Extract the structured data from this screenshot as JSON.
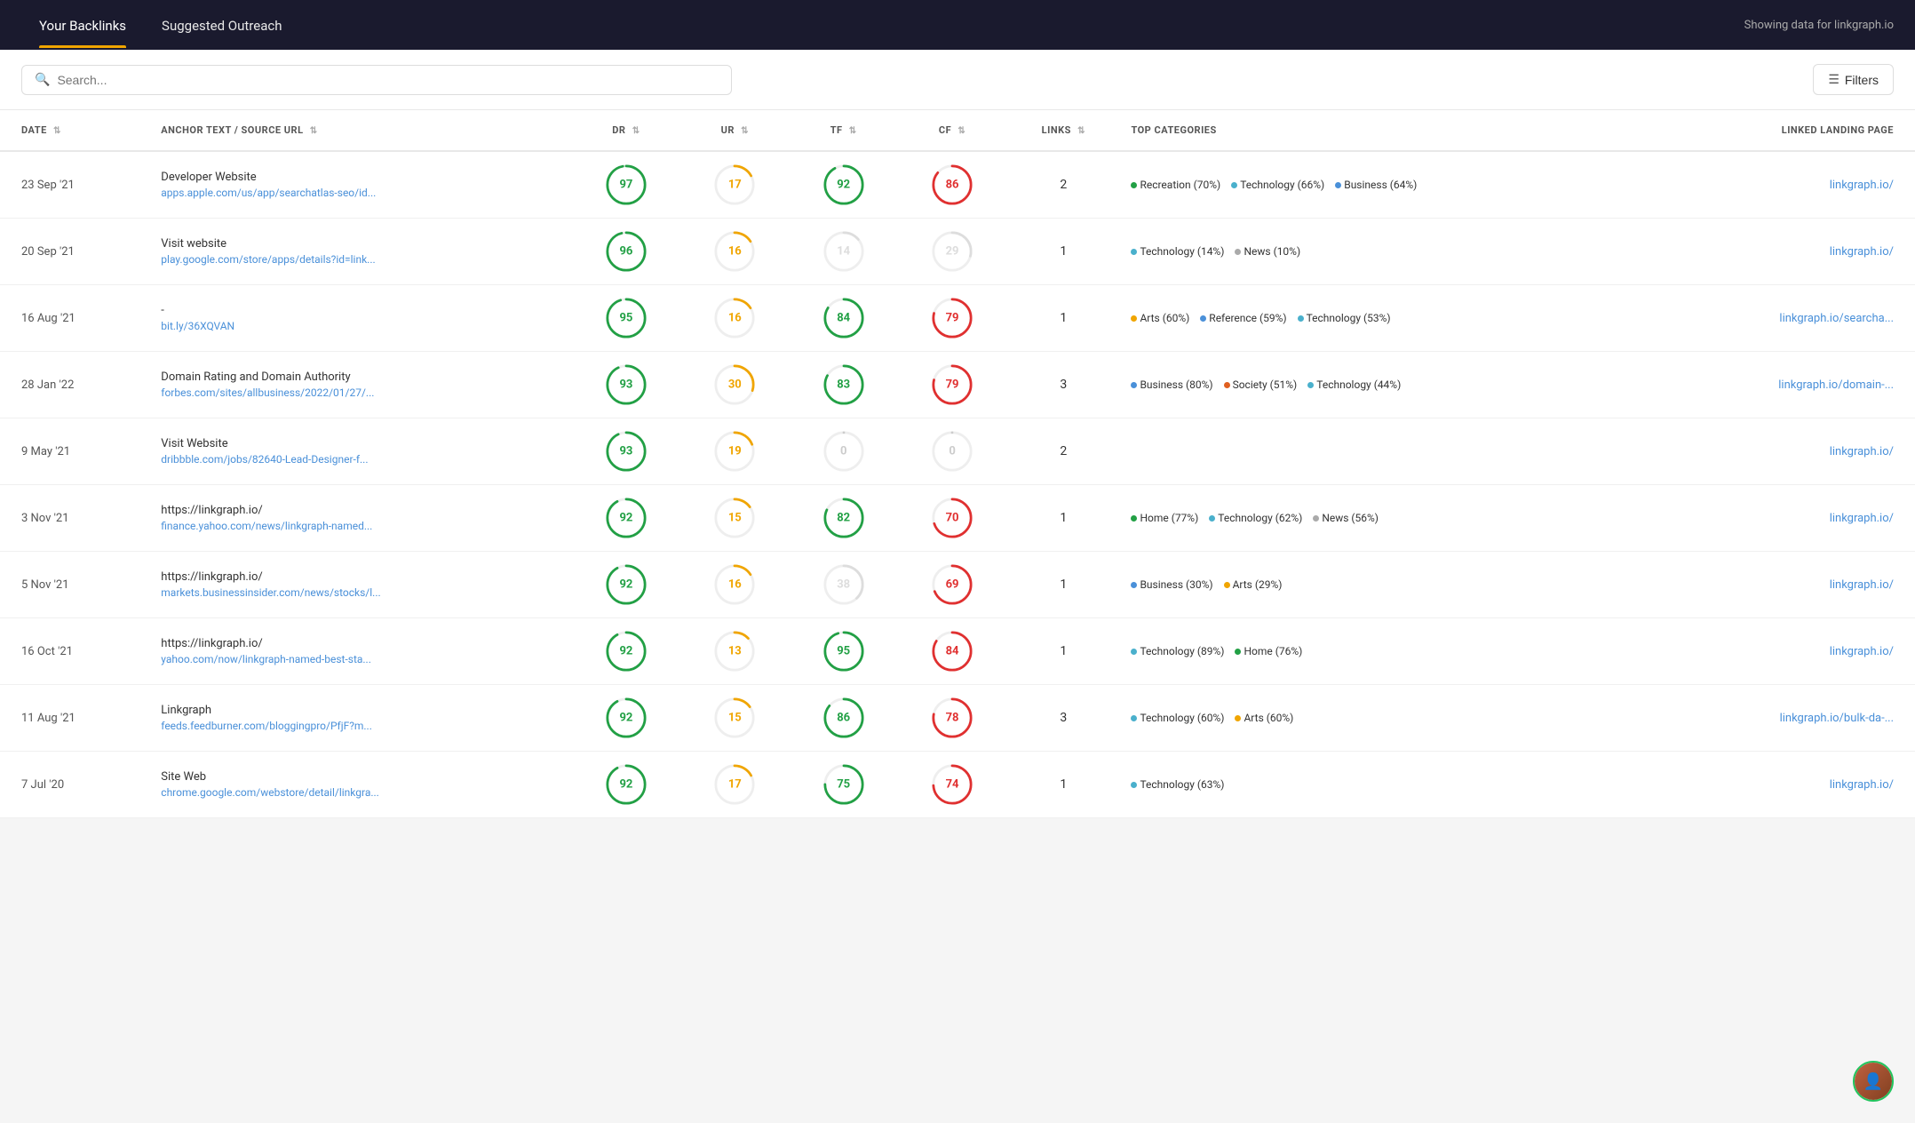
{
  "nav": {
    "tab1": "Your Backlinks",
    "tab2": "Suggested Outreach",
    "showing": "Showing data for linkgraph.io"
  },
  "toolbar": {
    "search_placeholder": "Search...",
    "filters_label": "Filters"
  },
  "table": {
    "columns": [
      "DATE",
      "ANCHOR TEXT / SOURCE URL",
      "DR",
      "UR",
      "TF",
      "CF",
      "LINKS",
      "TOP CATEGORIES",
      "LINKED LANDING PAGE"
    ],
    "rows": [
      {
        "date": "23 Sep '21",
        "anchor": "Developer Website",
        "url": "apps.apple.com/us/app/searchatlas-seo/id...",
        "dr": 97,
        "dr_color": "#22a045",
        "dr_stroke": "#22a045",
        "dr_pct": 97,
        "ur": 17,
        "ur_color": "#f0a500",
        "ur_stroke": "#f0a500",
        "ur_pct": 17,
        "tf": 92,
        "tf_color": "#22a045",
        "tf_stroke": "#22a045",
        "tf_pct": 92,
        "cf": 86,
        "cf_color": "#e03030",
        "cf_stroke": "#e03030",
        "cf_pct": 86,
        "links": 2,
        "categories": [
          {
            "dot": "#22a045",
            "label": "Recreation (70%)"
          },
          {
            "dot": "#4ab0cc",
            "label": "Technology (66%)"
          },
          {
            "dot": "#4a90d9",
            "label": "Business (64%)"
          }
        ],
        "landing": "linkgraph.io/"
      },
      {
        "date": "20 Sep '21",
        "anchor": "Visit website",
        "url": "play.google.com/store/apps/details?id=link...",
        "dr": 96,
        "dr_color": "#22a045",
        "dr_stroke": "#22a045",
        "dr_pct": 96,
        "ur": 16,
        "ur_color": "#f0a500",
        "ur_stroke": "#f0a500",
        "ur_pct": 16,
        "tf": 14,
        "tf_color": "#999",
        "tf_stroke": "#ddd",
        "tf_pct": 14,
        "cf": 29,
        "cf_color": "#999",
        "cf_stroke": "#ddd",
        "cf_pct": 29,
        "links": 1,
        "categories": [
          {
            "dot": "#4ab0cc",
            "label": "Technology (14%)"
          },
          {
            "dot": "#aaa",
            "label": "News (10%)"
          }
        ],
        "landing": "linkgraph.io/"
      },
      {
        "date": "16 Aug '21",
        "anchor": "-",
        "url": "bit.ly/36XQVAN",
        "dr": 95,
        "dr_color": "#22a045",
        "dr_stroke": "#22a045",
        "dr_pct": 95,
        "ur": 16,
        "ur_color": "#f0a500",
        "ur_stroke": "#f0a500",
        "ur_pct": 16,
        "tf": 84,
        "tf_color": "#22a045",
        "tf_stroke": "#22a045",
        "tf_pct": 84,
        "cf": 79,
        "cf_color": "#e03030",
        "cf_stroke": "#e03030",
        "cf_pct": 79,
        "links": 1,
        "categories": [
          {
            "dot": "#f0a500",
            "label": "Arts (60%)"
          },
          {
            "dot": "#4a90d9",
            "label": "Reference (59%)"
          },
          {
            "dot": "#4ab0cc",
            "label": "Technology (53%)"
          }
        ],
        "landing": "linkgraph.io/searcha..."
      },
      {
        "date": "28 Jan '22",
        "anchor": "Domain Rating and Domain Authority",
        "url": "forbes.com/sites/allbusiness/2022/01/27/...",
        "dr": 93,
        "dr_color": "#22a045",
        "dr_stroke": "#22a045",
        "dr_pct": 93,
        "ur": 30,
        "ur_color": "#f0a500",
        "ur_stroke": "#f0a500",
        "ur_pct": 30,
        "tf": 83,
        "tf_color": "#22a045",
        "tf_stroke": "#22a045",
        "tf_pct": 83,
        "cf": 79,
        "cf_color": "#e03030",
        "cf_stroke": "#e03030",
        "cf_pct": 79,
        "links": 3,
        "categories": [
          {
            "dot": "#4a90d9",
            "label": "Business (80%)"
          },
          {
            "dot": "#e06020",
            "label": "Society (51%)"
          },
          {
            "dot": "#4ab0cc",
            "label": "Technology (44%)"
          }
        ],
        "landing": "linkgraph.io/domain-..."
      },
      {
        "date": "9 May '21",
        "anchor": "Visit Website",
        "url": "dribbble.com/jobs/82640-Lead-Designer-f...",
        "dr": 93,
        "dr_color": "#22a045",
        "dr_stroke": "#22a045",
        "dr_pct": 93,
        "ur": 19,
        "ur_color": "#f0a500",
        "ur_stroke": "#f0a500",
        "ur_pct": 19,
        "tf": 0,
        "tf_color": "#999",
        "tf_stroke": "#ddd",
        "tf_pct": 0,
        "cf": 0,
        "cf_color": "#999",
        "cf_stroke": "#ddd",
        "cf_pct": 0,
        "links": 2,
        "categories": [],
        "landing": "linkgraph.io/"
      },
      {
        "date": "3 Nov '21",
        "anchor": "https://linkgraph.io/",
        "url": "finance.yahoo.com/news/linkgraph-named...",
        "dr": 92,
        "dr_color": "#22a045",
        "dr_stroke": "#22a045",
        "dr_pct": 92,
        "ur": 15,
        "ur_color": "#f0a500",
        "ur_stroke": "#f0a500",
        "ur_pct": 15,
        "tf": 82,
        "tf_color": "#22a045",
        "tf_stroke": "#22a045",
        "tf_pct": 82,
        "cf": 70,
        "cf_color": "#e03030",
        "cf_stroke": "#e03030",
        "cf_pct": 70,
        "links": 1,
        "categories": [
          {
            "dot": "#22a045",
            "label": "Home (77%)"
          },
          {
            "dot": "#4ab0cc",
            "label": "Technology (62%)"
          },
          {
            "dot": "#aaa",
            "label": "News (56%)"
          }
        ],
        "landing": "linkgraph.io/"
      },
      {
        "date": "5 Nov '21",
        "anchor": "https://linkgraph.io/",
        "url": "markets.businessinsider.com/news/stocks/l...",
        "dr": 92,
        "dr_color": "#22a045",
        "dr_stroke": "#22a045",
        "dr_pct": 92,
        "ur": 16,
        "ur_color": "#f0a500",
        "ur_stroke": "#f0a500",
        "ur_pct": 16,
        "tf": 38,
        "tf_color": "#999",
        "tf_stroke": "#ddd",
        "tf_pct": 38,
        "cf": 69,
        "cf_color": "#e03030",
        "cf_stroke": "#e03030",
        "cf_pct": 69,
        "links": 1,
        "categories": [
          {
            "dot": "#4a90d9",
            "label": "Business (30%)"
          },
          {
            "dot": "#f0a500",
            "label": "Arts (29%)"
          }
        ],
        "landing": "linkgraph.io/"
      },
      {
        "date": "16 Oct '21",
        "anchor": "https://linkgraph.io/",
        "url": "yahoo.com/now/linkgraph-named-best-sta...",
        "dr": 92,
        "dr_color": "#22a045",
        "dr_stroke": "#22a045",
        "dr_pct": 92,
        "ur": 13,
        "ur_color": "#f0a500",
        "ur_stroke": "#f0a500",
        "ur_pct": 13,
        "tf": 95,
        "tf_color": "#22a045",
        "tf_stroke": "#22a045",
        "tf_pct": 95,
        "cf": 84,
        "cf_color": "#e03030",
        "cf_stroke": "#e03030",
        "cf_pct": 84,
        "links": 1,
        "categories": [
          {
            "dot": "#4ab0cc",
            "label": "Technology (89%)"
          },
          {
            "dot": "#22a045",
            "label": "Home (76%)"
          }
        ],
        "landing": "linkgraph.io/"
      },
      {
        "date": "11 Aug '21",
        "anchor": "Linkgraph",
        "url": "feeds.feedburner.com/bloggingpro/PfjF?m...",
        "dr": 92,
        "dr_color": "#22a045",
        "dr_stroke": "#22a045",
        "dr_pct": 92,
        "ur": 15,
        "ur_color": "#f0a500",
        "ur_stroke": "#f0a500",
        "ur_pct": 15,
        "tf": 86,
        "tf_color": "#22a045",
        "tf_stroke": "#22a045",
        "tf_pct": 86,
        "cf": 78,
        "cf_color": "#e03030",
        "cf_stroke": "#e03030",
        "cf_pct": 78,
        "links": 3,
        "categories": [
          {
            "dot": "#4ab0cc",
            "label": "Technology (60%)"
          },
          {
            "dot": "#f0a500",
            "label": "Arts (60%)"
          }
        ],
        "landing": "linkgraph.io/bulk-da-..."
      },
      {
        "date": "7 Jul '20",
        "anchor": "Site Web",
        "url": "chrome.google.com/webstore/detail/linkgra...",
        "dr": 92,
        "dr_color": "#22a045",
        "dr_stroke": "#22a045",
        "dr_pct": 92,
        "ur": 17,
        "ur_color": "#f0a500",
        "ur_stroke": "#f0a500",
        "ur_pct": 17,
        "tf": 75,
        "tf_color": "#22a045",
        "tf_stroke": "#22a045",
        "tf_pct": 75,
        "cf": 74,
        "cf_color": "#e03030",
        "cf_stroke": "#e03030",
        "cf_pct": 74,
        "links": 1,
        "categories": [
          {
            "dot": "#4ab0cc",
            "label": "Technology (63%)"
          }
        ],
        "landing": "linkgraph.io/"
      }
    ]
  }
}
